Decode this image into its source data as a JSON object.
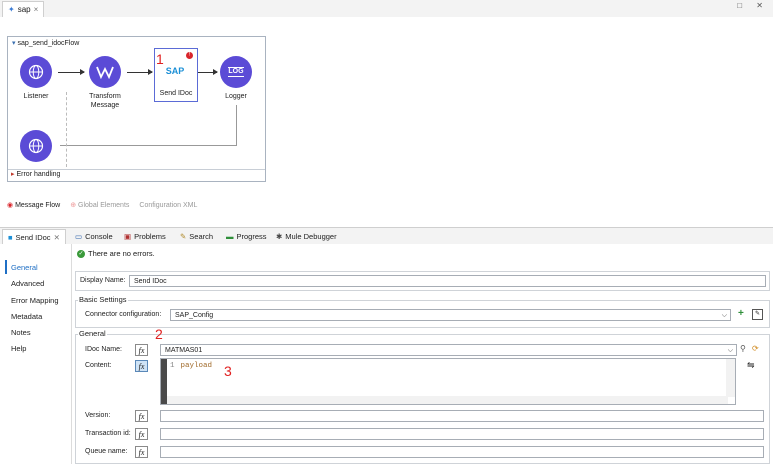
{
  "editor": {
    "tab_label": "sap",
    "tab_close": "×",
    "window_controls": "□ ✕"
  },
  "flow": {
    "name": "sap_send_idocFlow",
    "nodes": [
      {
        "label": "Listener"
      },
      {
        "label": "Transform Message"
      },
      {
        "label": "Send IDoc",
        "logo_text": "SAP"
      },
      {
        "label": "Logger",
        "logo_text": "LOG"
      }
    ],
    "error_handling_label": "Error handling"
  },
  "view_tabs": [
    {
      "label": "Message Flow"
    },
    {
      "label": "Global Elements"
    },
    {
      "label": "Configuration XML"
    }
  ],
  "annotations": [
    "1",
    "2",
    "3"
  ],
  "panel_tabs": [
    {
      "label": "Send IDoc"
    },
    {
      "label": "Console"
    },
    {
      "label": "Problems"
    },
    {
      "label": "Search"
    },
    {
      "label": "Progress"
    },
    {
      "label": "Mule Debugger"
    }
  ],
  "side_nav": [
    {
      "label": "General"
    },
    {
      "label": "Advanced"
    },
    {
      "label": "Error Mapping"
    },
    {
      "label": "Metadata"
    },
    {
      "label": "Notes"
    },
    {
      "label": "Help"
    }
  ],
  "status": {
    "message": "There are no errors."
  },
  "form": {
    "display_name_label": "Display Name:",
    "display_name_value": "Send IDoc",
    "basic_settings_label": "Basic Settings",
    "connector_config_label": "Connector configuration:",
    "connector_config_value": "SAP_Config",
    "general_label": "General",
    "idoc_name_label": "IDoc Name:",
    "idoc_name_value": "MATMAS01",
    "content_label": "Content:",
    "content_line_number": "1",
    "content_code": "payload",
    "version_label": "Version:",
    "version_value": "",
    "transaction_label": "Transaction id:",
    "transaction_value": "",
    "queue_label": "Queue name:",
    "queue_value": "",
    "fx_label": "fx"
  },
  "colors": {
    "accent": "#1f6fc5",
    "node": "#5b4bd6",
    "error": "#d9262c",
    "annotation": "#e02020"
  }
}
